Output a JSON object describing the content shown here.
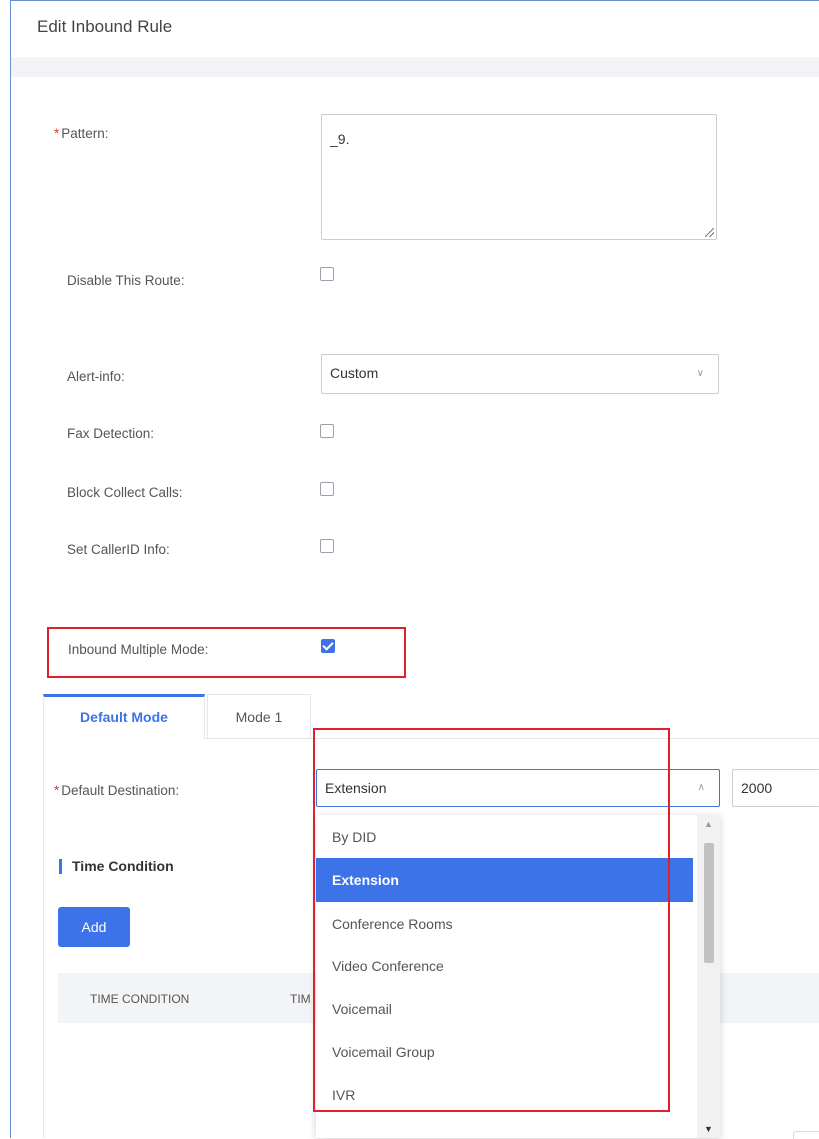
{
  "title": "Edit Inbound Rule",
  "form": {
    "pattern_label": "Pattern",
    "pattern_value": "_9.",
    "disable_route_label": "Disable This Route",
    "alert_info_label": "Alert-info",
    "alert_info_value": "Custom",
    "fax_detection_label": "Fax Detection",
    "block_collect_label": "Block Collect Calls",
    "set_callerid_label": "Set CallerID Info",
    "inbound_multiple_label": "Inbound Multiple Mode",
    "inbound_multiple_checked": true,
    "required_mark": "*",
    "colon": ":"
  },
  "tabs": [
    {
      "label": "Default Mode",
      "active": true
    },
    {
      "label": "Mode 1",
      "active": false
    }
  ],
  "default_destination": {
    "label": "Default Destination",
    "value": "Extension",
    "extension_value": "2000"
  },
  "time_condition": {
    "title": "Time Condition",
    "add_label": "Add",
    "columns": [
      "TIME CONDITION",
      "TIM"
    ]
  },
  "dropdown_options": [
    {
      "label": "By DID",
      "selected": false
    },
    {
      "label": "Extension",
      "selected": true
    },
    {
      "label": "Conference Rooms",
      "selected": false
    },
    {
      "label": "Video Conference",
      "selected": false
    },
    {
      "label": "Voicemail",
      "selected": false
    },
    {
      "label": "Voicemail Group",
      "selected": false
    },
    {
      "label": "IVR",
      "selected": false
    }
  ],
  "colors": {
    "accent": "#3d73e8",
    "highlight": "#e0202a"
  },
  "icons": {
    "select_chevron_down": "chevron-down-icon",
    "select_chevron_up": "chevron-up-icon",
    "check": "check-icon"
  }
}
